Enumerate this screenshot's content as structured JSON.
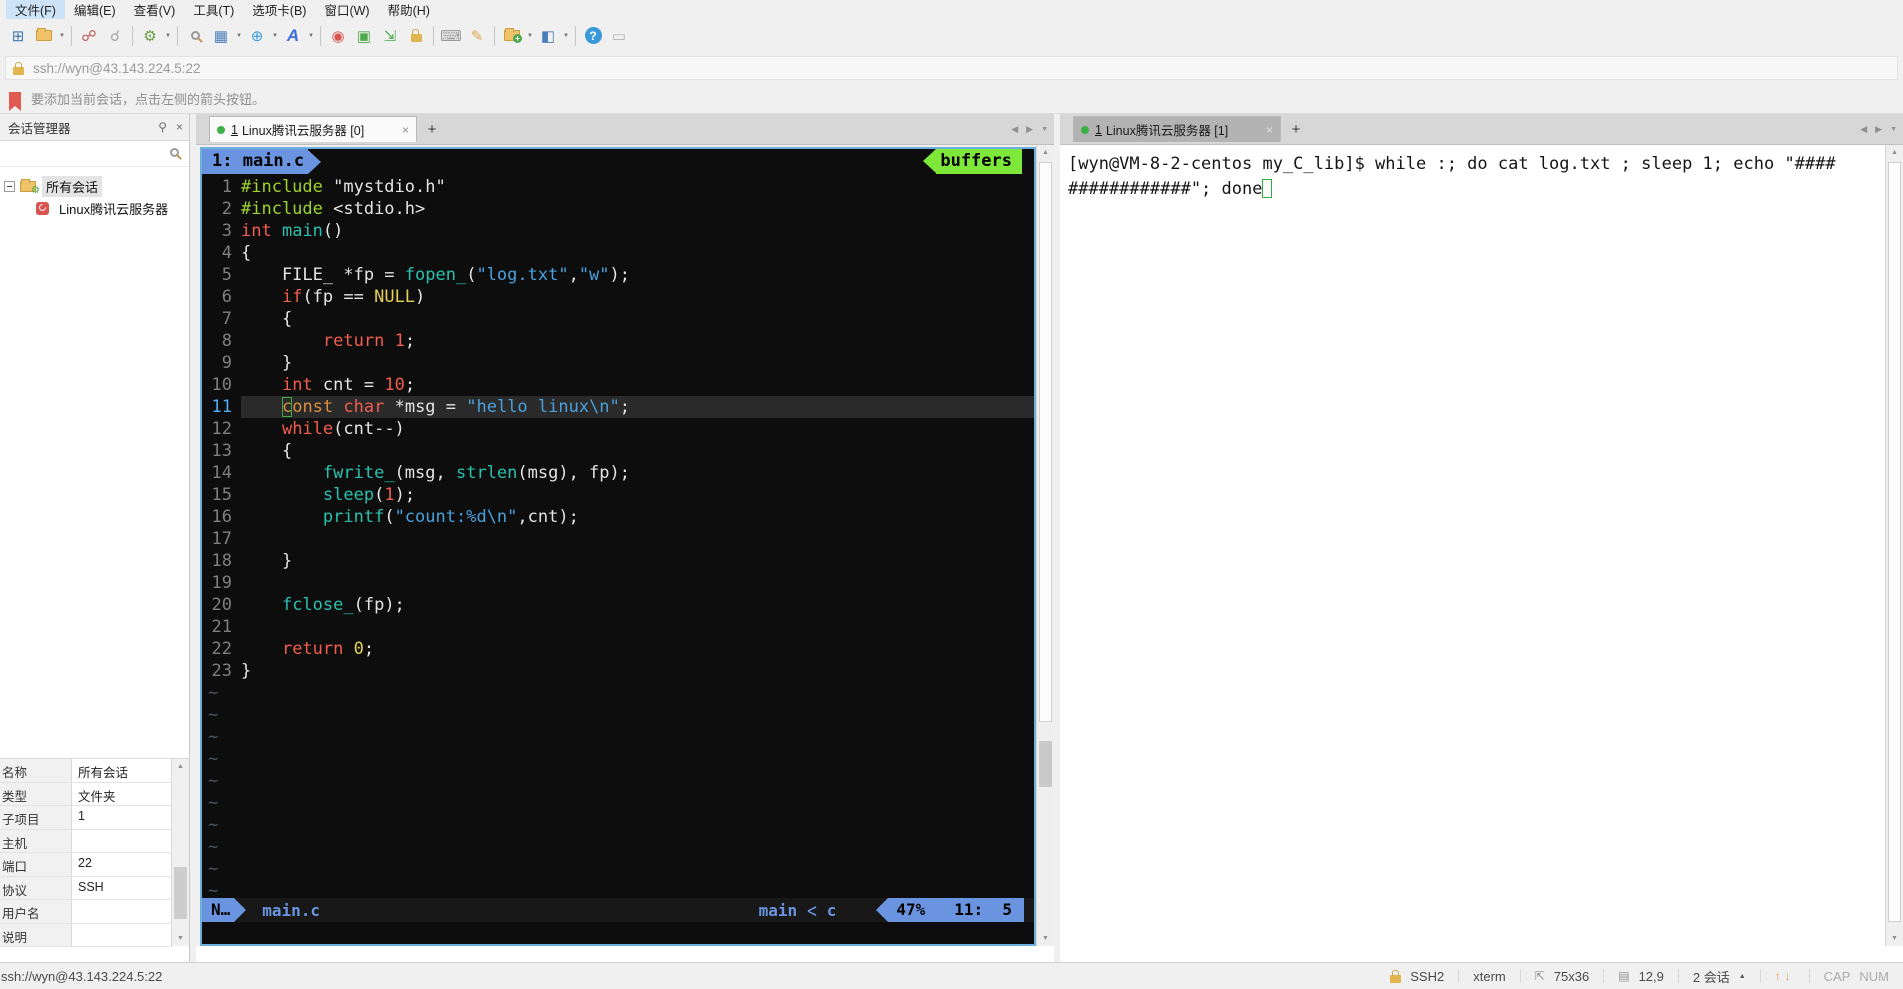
{
  "menu": {
    "items": [
      {
        "name": "file",
        "label": "文件(F)",
        "active": true
      },
      {
        "name": "edit",
        "label": "编辑(E)",
        "active": false
      },
      {
        "name": "view",
        "label": "查看(V)",
        "active": false
      },
      {
        "name": "tools",
        "label": "工具(T)",
        "active": false
      },
      {
        "name": "tab",
        "label": "选项卡(B)",
        "active": false
      },
      {
        "name": "window",
        "label": "窗口(W)",
        "active": false
      },
      {
        "name": "help",
        "label": "帮助(H)",
        "active": false
      }
    ]
  },
  "toolbar": {
    "icons": [
      {
        "name": "new-session-icon",
        "glyph": "⊞",
        "color": "#3c78b4"
      },
      {
        "name": "open-session-icon",
        "type": "folder",
        "dropdown": true
      },
      {
        "sep": true
      },
      {
        "name": "disconnect-icon",
        "glyph": "☍",
        "color": "#c0504d"
      },
      {
        "name": "reconnect-icon",
        "glyph": "☌",
        "color": "#a8a8a8"
      },
      {
        "sep": true
      },
      {
        "name": "session-properties-icon",
        "glyph": "⚙",
        "color": "#6b9e3f",
        "dropdown": true
      },
      {
        "sep": true
      },
      {
        "name": "find-icon",
        "type": "search"
      },
      {
        "name": "layout-icon",
        "glyph": "▦",
        "color": "#4a7ebb",
        "dropdown": true
      },
      {
        "name": "web-icon",
        "glyph": "⊕",
        "color": "#3a9ad9",
        "dropdown": true
      },
      {
        "name": "font-icon",
        "glyph": "A",
        "color": "#3a6fd8",
        "italic": true,
        "dropdown": true
      },
      {
        "sep": true
      },
      {
        "name": "record-icon",
        "glyph": "◉",
        "color": "#d9534f"
      },
      {
        "name": "package-icon",
        "glyph": "▣",
        "color": "#4ea94e"
      },
      {
        "name": "fullscreen-icon",
        "glyph": "⇲",
        "color": "#4ea94e"
      },
      {
        "name": "lock-icon",
        "type": "lock"
      },
      {
        "sep": true
      },
      {
        "name": "keyboard-icon",
        "glyph": "⌨",
        "color": "#9a9a9a"
      },
      {
        "name": "highlighter-icon",
        "glyph": "✎",
        "color": "#e0a44e"
      },
      {
        "sep": true
      },
      {
        "name": "new-folder-icon",
        "type": "folder",
        "badge": "+",
        "dropdown": true
      },
      {
        "name": "window-split-icon",
        "glyph": "◧",
        "color": "#4a7ebb",
        "dropdown": true
      },
      {
        "sep": true
      },
      {
        "name": "help-icon",
        "glyph": "?",
        "color": "#ffffff",
        "bg": "#3a9ad9",
        "round": true
      },
      {
        "name": "chat-icon",
        "glyph": "▭",
        "color": "#b5b5b5"
      }
    ]
  },
  "address": {
    "url": "ssh://wyn@43.143.224.5:22"
  },
  "infobar": {
    "text": "要添加当前会话，点击左侧的箭头按钮。"
  },
  "sidebar": {
    "title": "会话管理器",
    "tree": {
      "items": [
        {
          "label": "所有会话",
          "type": "folder",
          "level": 0,
          "selected": true
        },
        {
          "label": "Linux腾讯云服务器",
          "type": "session",
          "level": 1,
          "selected": false
        }
      ]
    },
    "properties": {
      "rows": [
        [
          "名称",
          "所有会话"
        ],
        [
          "类型",
          "文件夹"
        ],
        [
          "子项目",
          "1"
        ],
        [
          "主机",
          ""
        ],
        [
          "端口",
          "22"
        ],
        [
          "协议",
          "SSH"
        ],
        [
          "用户名",
          ""
        ],
        [
          "说明",
          ""
        ]
      ]
    }
  },
  "left_tab": {
    "index": "1",
    "label": "Linux腾讯云服务器 [0]"
  },
  "right_tab": {
    "index": "1",
    "label": "Linux腾讯云服务器 [1]"
  },
  "vim": {
    "buffer_tab": "1: main.c",
    "buffers_label": "buffers",
    "mode": "N…",
    "file": "main.c",
    "branch": "main",
    "filetype": "c",
    "percent": "47%",
    "position": "11:  5",
    "tilde_rows": 10,
    "lines": [
      {
        "n": "1",
        "t": [
          [
            "pre",
            "#include"
          ],
          [
            "pl",
            " \"mystdio.h\""
          ]
        ]
      },
      {
        "n": "2",
        "t": [
          [
            "pre",
            "#include"
          ],
          [
            "pl",
            " <stdio.h>"
          ]
        ]
      },
      {
        "n": "3",
        "t": [
          [
            "kw",
            "int"
          ],
          [
            "pl",
            " "
          ],
          [
            "fn",
            "main"
          ],
          [
            "pl",
            "()"
          ]
        ]
      },
      {
        "n": "4",
        "t": [
          [
            "pl",
            "{"
          ]
        ]
      },
      {
        "n": "5",
        "t": [
          [
            "pl",
            "    FILE_ *fp = "
          ],
          [
            "fn",
            "fopen_"
          ],
          [
            "pl",
            "("
          ],
          [
            "str",
            "\"log.txt\""
          ],
          [
            "pl",
            ","
          ],
          [
            "str",
            "\"w\""
          ],
          [
            "pl",
            ");"
          ]
        ]
      },
      {
        "n": "6",
        "t": [
          [
            "pl",
            "    "
          ],
          [
            "kw",
            "if"
          ],
          [
            "pl",
            "(fp == "
          ],
          [
            "yel",
            "NULL"
          ],
          [
            "pl",
            ")"
          ]
        ]
      },
      {
        "n": "7",
        "t": [
          [
            "pl",
            "    {"
          ]
        ]
      },
      {
        "n": "8",
        "t": [
          [
            "pl",
            "        "
          ],
          [
            "kw",
            "return"
          ],
          [
            "pl",
            " "
          ],
          [
            "num",
            "1"
          ],
          [
            "pl",
            ";"
          ]
        ]
      },
      {
        "n": "9",
        "t": [
          [
            "pl",
            "    }"
          ]
        ]
      },
      {
        "n": "10",
        "t": [
          [
            "pl",
            "    "
          ],
          [
            "kw",
            "int"
          ],
          [
            "pl",
            " cnt = "
          ],
          [
            "num",
            "10"
          ],
          [
            "pl",
            ";"
          ]
        ]
      },
      {
        "n": "11",
        "cur": true,
        "t": [
          [
            "pl",
            "    "
          ],
          [
            "org cur",
            "c"
          ],
          [
            "org",
            "onst"
          ],
          [
            "pl",
            " "
          ],
          [
            "kw",
            "char"
          ],
          [
            "pl",
            " *msg = "
          ],
          [
            "str",
            "\"hello linux\\n\""
          ],
          [
            "pl",
            ";"
          ]
        ]
      },
      {
        "n": "12",
        "t": [
          [
            "pl",
            "    "
          ],
          [
            "kw",
            "while"
          ],
          [
            "pl",
            "(cnt--)"
          ]
        ]
      },
      {
        "n": "13",
        "t": [
          [
            "pl",
            "    {"
          ]
        ]
      },
      {
        "n": "14",
        "t": [
          [
            "pl",
            "        "
          ],
          [
            "fn",
            "fwrite_"
          ],
          [
            "pl",
            "(msg, "
          ],
          [
            "fn",
            "strlen"
          ],
          [
            "pl",
            "(msg), fp);"
          ]
        ]
      },
      {
        "n": "15",
        "t": [
          [
            "pl",
            "        "
          ],
          [
            "fn",
            "sleep"
          ],
          [
            "pl",
            "("
          ],
          [
            "num",
            "1"
          ],
          [
            "pl",
            ");"
          ]
        ]
      },
      {
        "n": "16",
        "t": [
          [
            "pl",
            "        "
          ],
          [
            "fn",
            "printf"
          ],
          [
            "pl",
            "("
          ],
          [
            "str",
            "\"count:%d\\n\""
          ],
          [
            "pl",
            ",cnt);"
          ]
        ]
      },
      {
        "n": "17",
        "t": []
      },
      {
        "n": "18",
        "t": [
          [
            "pl",
            "    }"
          ]
        ]
      },
      {
        "n": "19",
        "t": []
      },
      {
        "n": "20",
        "t": [
          [
            "pl",
            "    "
          ],
          [
            "fn",
            "fclose_"
          ],
          [
            "pl",
            "(fp);"
          ]
        ]
      },
      {
        "n": "21",
        "t": []
      },
      {
        "n": "22",
        "t": [
          [
            "pl",
            "    "
          ],
          [
            "kw",
            "return"
          ],
          [
            "pl",
            " "
          ],
          [
            "yel",
            "0"
          ],
          [
            "pl",
            ";"
          ]
        ]
      },
      {
        "n": "23",
        "t": [
          [
            "pl",
            "}"
          ]
        ]
      }
    ]
  },
  "terminal": {
    "lines": [
      "[wyn@VM-8-2-centos my_C_lib]$ while :; do cat log.txt ; sleep 1; echo \"####",
      "############\"; done"
    ]
  },
  "statusbar": {
    "url": "ssh://wyn@43.143.224.5:22",
    "protocol": "SSH2",
    "termtype": "xterm",
    "size": "75x36",
    "cursor": "12,9",
    "sessions": "2 会话",
    "cap": "CAP",
    "num": "NUM"
  }
}
